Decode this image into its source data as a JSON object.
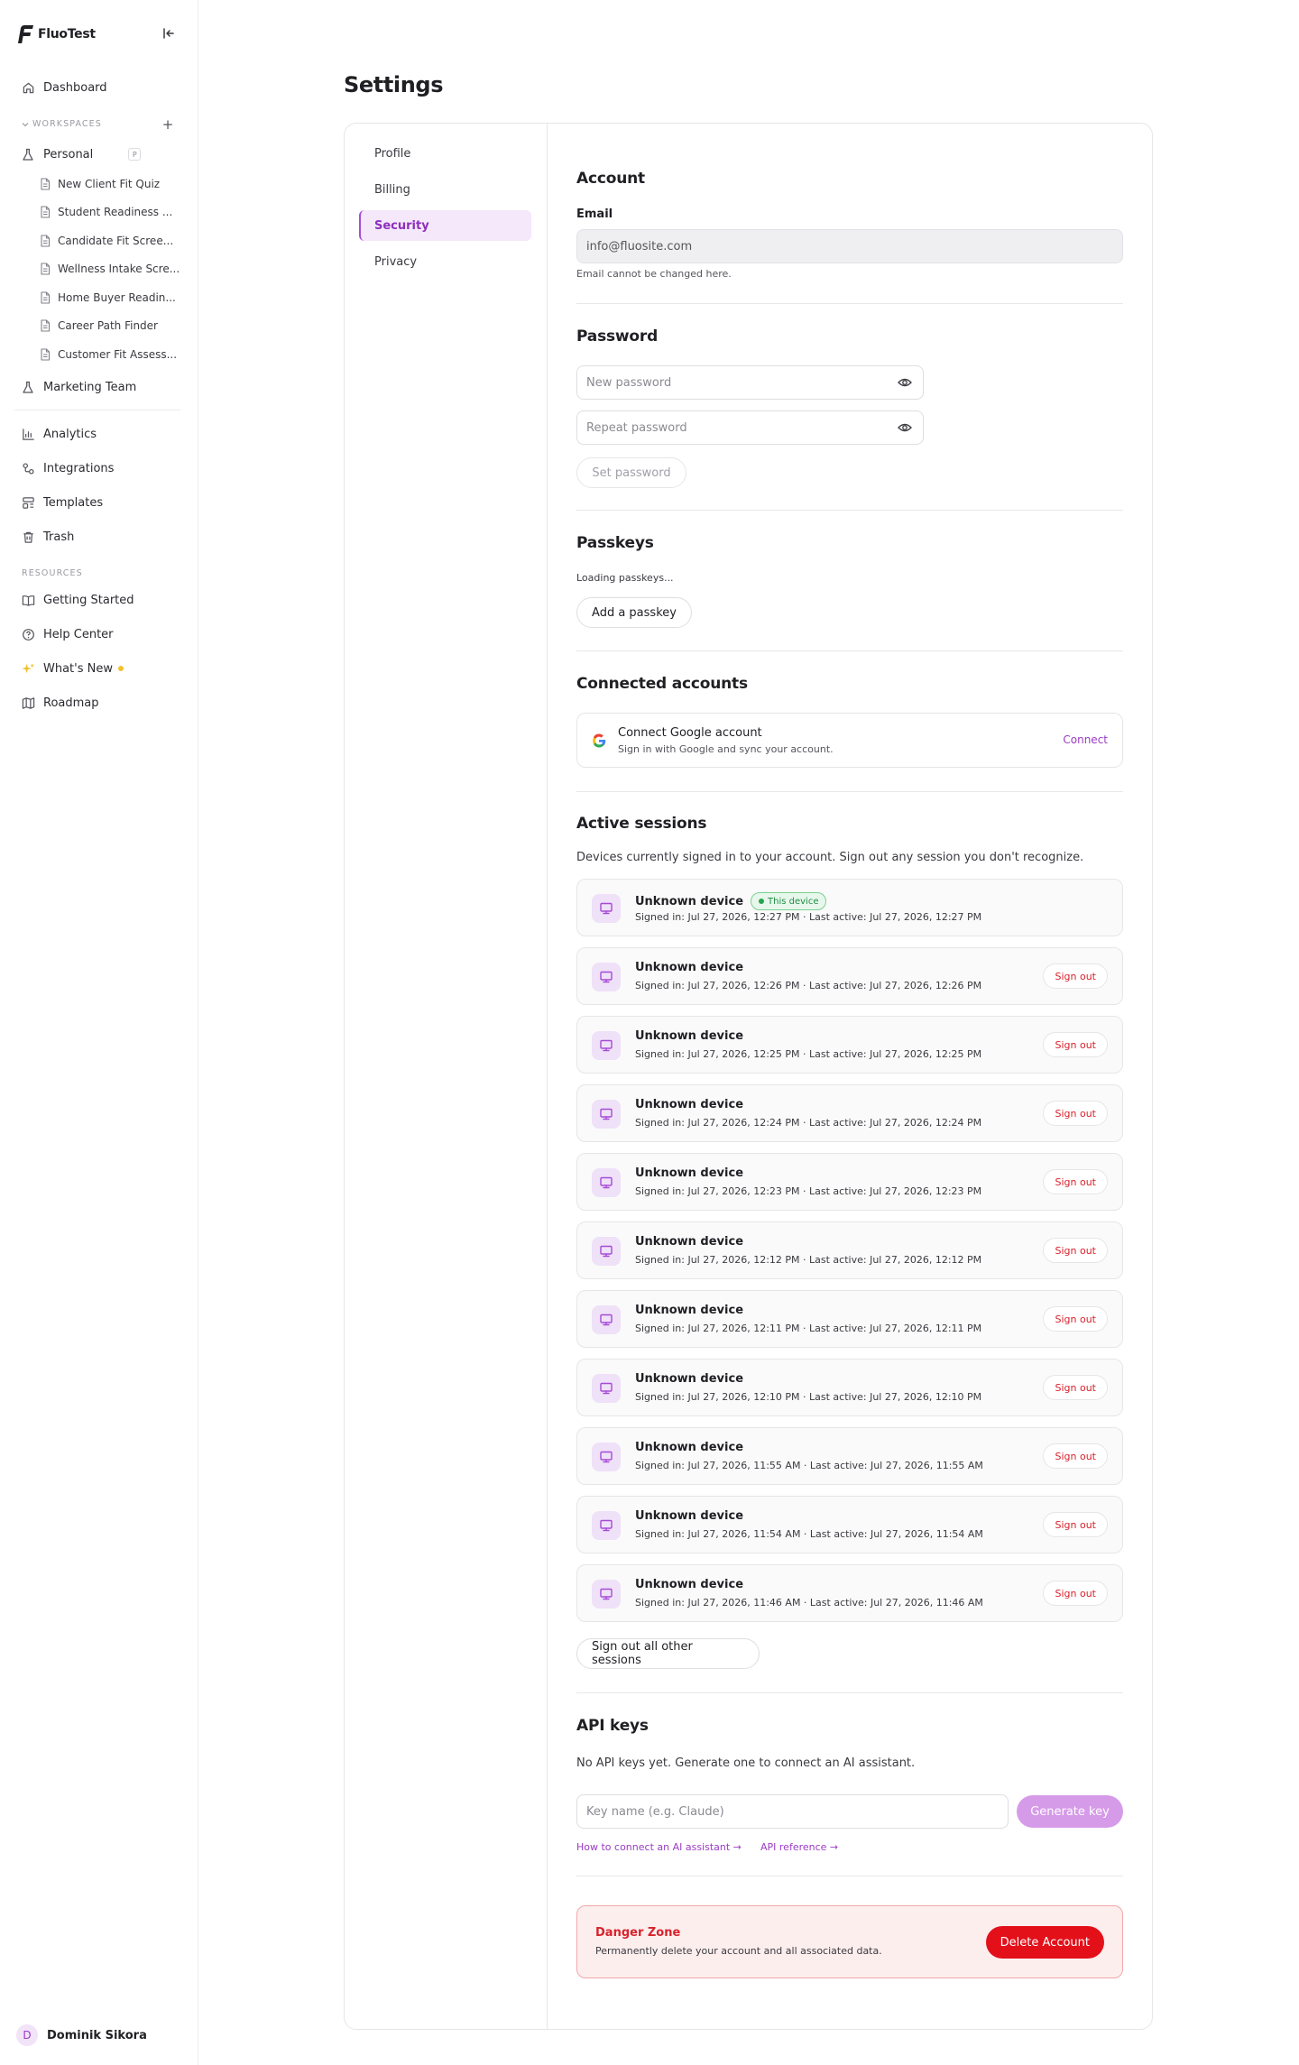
{
  "app": {
    "name": "FluoTest"
  },
  "sidebar": {
    "dashboard": "Dashboard",
    "workspaces_label": "WORKSPACES",
    "personal": {
      "label": "Personal",
      "badge": "P"
    },
    "quizzes": [
      "New Client Fit Quiz",
      "Student Readiness ...",
      "Candidate Fit Scree...",
      "Wellness Intake Scre...",
      "Home Buyer Readin...",
      "Career Path Finder",
      "Customer Fit Assess..."
    ],
    "marketing": "Marketing Team",
    "main_items": [
      "Analytics",
      "Integrations",
      "Templates",
      "Trash"
    ],
    "resources_label": "RESOURCES",
    "resources": [
      "Getting Started",
      "Help Center",
      "What's New",
      "Roadmap"
    ],
    "user": {
      "initial": "D",
      "name": "Dominik Sikora"
    }
  },
  "page": {
    "title": "Settings"
  },
  "settings_nav": [
    "Profile",
    "Billing",
    "Security",
    "Privacy"
  ],
  "account": {
    "heading": "Account",
    "email_label": "Email",
    "email_value": "info@fluosite.com",
    "email_hint": "Email cannot be changed here."
  },
  "password": {
    "heading": "Password",
    "new_placeholder": "New password",
    "repeat_placeholder": "Repeat password",
    "set_button": "Set password"
  },
  "passkeys": {
    "heading": "Passkeys",
    "loading": "Loading passkeys...",
    "add_button": "Add a passkey"
  },
  "connected": {
    "heading": "Connected accounts",
    "google_title": "Connect Google account",
    "google_sub": "Sign in with Google and sync your account.",
    "connect_link": "Connect"
  },
  "sessions": {
    "heading": "Active sessions",
    "description": "Devices currently signed in to your account. Sign out any session you don't recognize.",
    "this_device_badge": "This device",
    "sign_out_label": "Sign out",
    "sign_out_all": "Sign out all other sessions",
    "items": [
      {
        "name": "Unknown device",
        "meta": "Signed in: Jul 27, 2026, 12:27 PM · Last active: Jul 27, 2026, 12:27 PM",
        "current": true
      },
      {
        "name": "Unknown device",
        "meta": "Signed in: Jul 27, 2026, 12:26 PM · Last active: Jul 27, 2026, 12:26 PM",
        "current": false
      },
      {
        "name": "Unknown device",
        "meta": "Signed in: Jul 27, 2026, 12:25 PM · Last active: Jul 27, 2026, 12:25 PM",
        "current": false
      },
      {
        "name": "Unknown device",
        "meta": "Signed in: Jul 27, 2026, 12:24 PM · Last active: Jul 27, 2026, 12:24 PM",
        "current": false
      },
      {
        "name": "Unknown device",
        "meta": "Signed in: Jul 27, 2026, 12:23 PM · Last active: Jul 27, 2026, 12:23 PM",
        "current": false
      },
      {
        "name": "Unknown device",
        "meta": "Signed in: Jul 27, 2026, 12:12 PM · Last active: Jul 27, 2026, 12:12 PM",
        "current": false
      },
      {
        "name": "Unknown device",
        "meta": "Signed in: Jul 27, 2026, 12:11 PM · Last active: Jul 27, 2026, 12:11 PM",
        "current": false
      },
      {
        "name": "Unknown device",
        "meta": "Signed in: Jul 27, 2026, 12:10 PM · Last active: Jul 27, 2026, 12:10 PM",
        "current": false
      },
      {
        "name": "Unknown device",
        "meta": "Signed in: Jul 27, 2026, 11:55 AM · Last active: Jul 27, 2026, 11:55 AM",
        "current": false
      },
      {
        "name": "Unknown device",
        "meta": "Signed in: Jul 27, 2026, 11:54 AM · Last active: Jul 27, 2026, 11:54 AM",
        "current": false
      },
      {
        "name": "Unknown device",
        "meta": "Signed in: Jul 27, 2026, 11:46 AM · Last active: Jul 27, 2026, 11:46 AM",
        "current": false
      }
    ]
  },
  "api_keys": {
    "heading": "API keys",
    "empty_text": "No API keys yet. Generate one to connect an AI assistant.",
    "key_placeholder": "Key name (e.g. Claude)",
    "generate_button": "Generate key",
    "link_connect": "How to connect an AI assistant →",
    "link_reference": "API reference →"
  },
  "danger": {
    "title": "Danger Zone",
    "subtitle": "Permanently delete your account and all associated data.",
    "delete_button": "Delete Account"
  },
  "colors": {
    "accent": "#9b3bc4",
    "accent_light": "#f4e8fa",
    "danger": "#e3101a",
    "success": "#27a450"
  }
}
